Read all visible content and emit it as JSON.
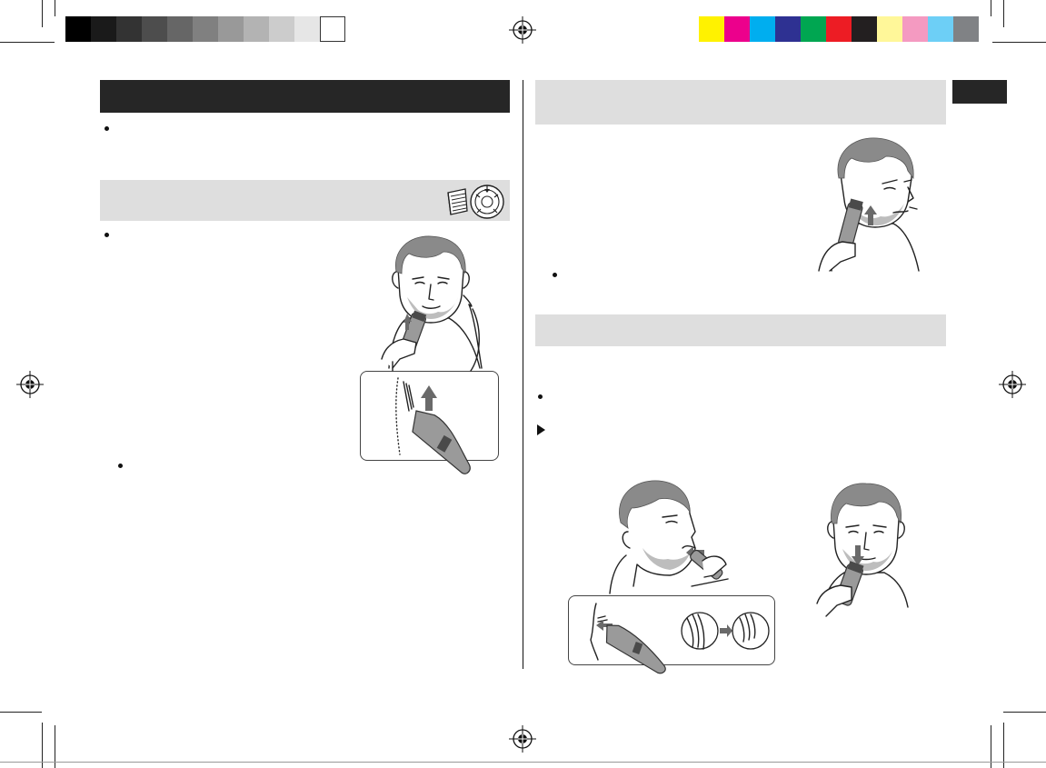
{
  "print_marks": {
    "grayscale_swatches": [
      "#000000",
      "#1a1a1a",
      "#333333",
      "#4d4d4d",
      "#666666",
      "#808080",
      "#999999",
      "#b3b3b3",
      "#cccccc",
      "#e6e6e6",
      "#ffffff"
    ],
    "color_swatches": [
      "#fff200",
      "#ec008c",
      "#00aeef",
      "#2e3192",
      "#00a651",
      "#ed1c24",
      "#231f20",
      "#fff799",
      "#f49ac1",
      "#6dcff6",
      "#808285"
    ],
    "icons": [
      "registration-target-icon"
    ]
  },
  "left_column": {
    "section_title": "",
    "bullet_text": "",
    "subsection_title": "",
    "subsection_bullets": [
      "",
      ""
    ],
    "icons": [
      "comb-attachment-icon",
      "length-dial-icon"
    ],
    "illustrations": [
      "man-trimming-neck",
      "trimmer-closeup-inset"
    ]
  },
  "right_column": {
    "section_title": "",
    "section_bullet": "",
    "subsection_title": "",
    "subsection_bullet": "",
    "subsection_note": "",
    "illustrations": [
      "man-trimming-cheek",
      "man-trimming-mustache",
      "man-trimming-chin",
      "mustache-closeup-inset"
    ]
  },
  "side_tab": {
    "label": ""
  }
}
